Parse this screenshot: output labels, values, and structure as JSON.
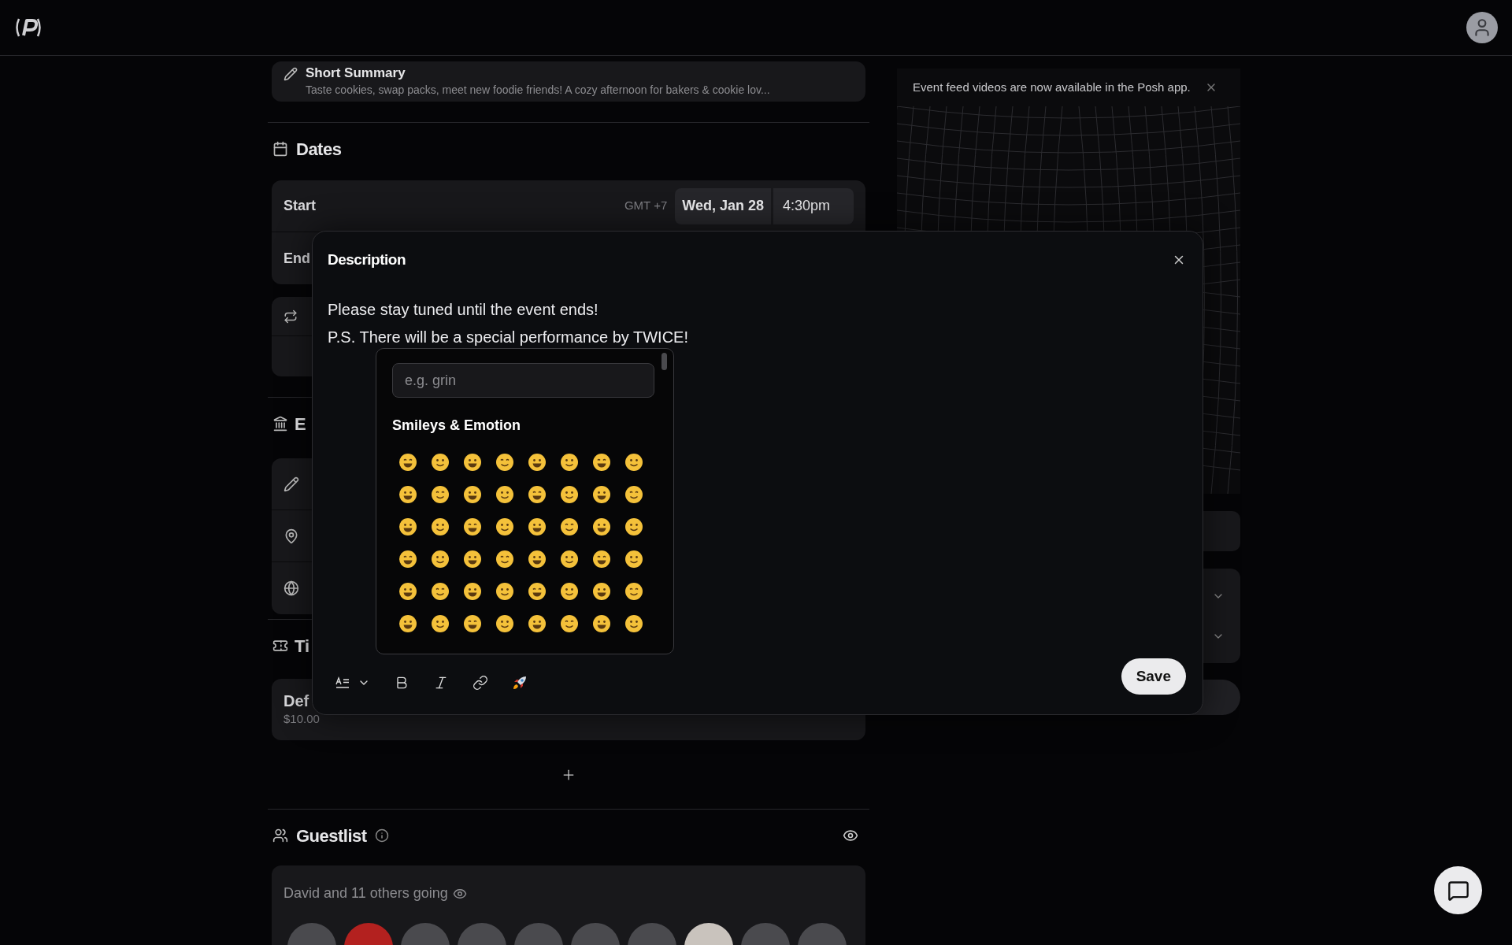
{
  "summary": {
    "label": "Short Summary",
    "text": "Taste cookies, swap packs, meet new foodie friends! A cozy afternoon for bakers & cookie lov..."
  },
  "dates": {
    "title": "Dates",
    "rows": [
      {
        "label": "Start",
        "timezone": "GMT +7",
        "date": "Wed, Jan 28",
        "time": "4:30pm"
      },
      {
        "label": "End"
      }
    ]
  },
  "event_section": {
    "title": "E"
  },
  "tickets_section": {
    "title": "Ti",
    "ticket": {
      "name": "Def",
      "price": "$10.00"
    }
  },
  "guestlist": {
    "title": "Guestlist",
    "summary": "David and 11 others going"
  },
  "banner": {
    "text": "Event feed videos are now available in the Posh app."
  },
  "modal": {
    "title": "Description",
    "lines": [
      "Please stay tuned until the event ends!",
      "P.S. There will be a special performance by TWICE!"
    ],
    "emoji_picker": {
      "placeholder": "e.g. grin",
      "category": "Smileys & Emotion"
    },
    "save": "Save"
  }
}
